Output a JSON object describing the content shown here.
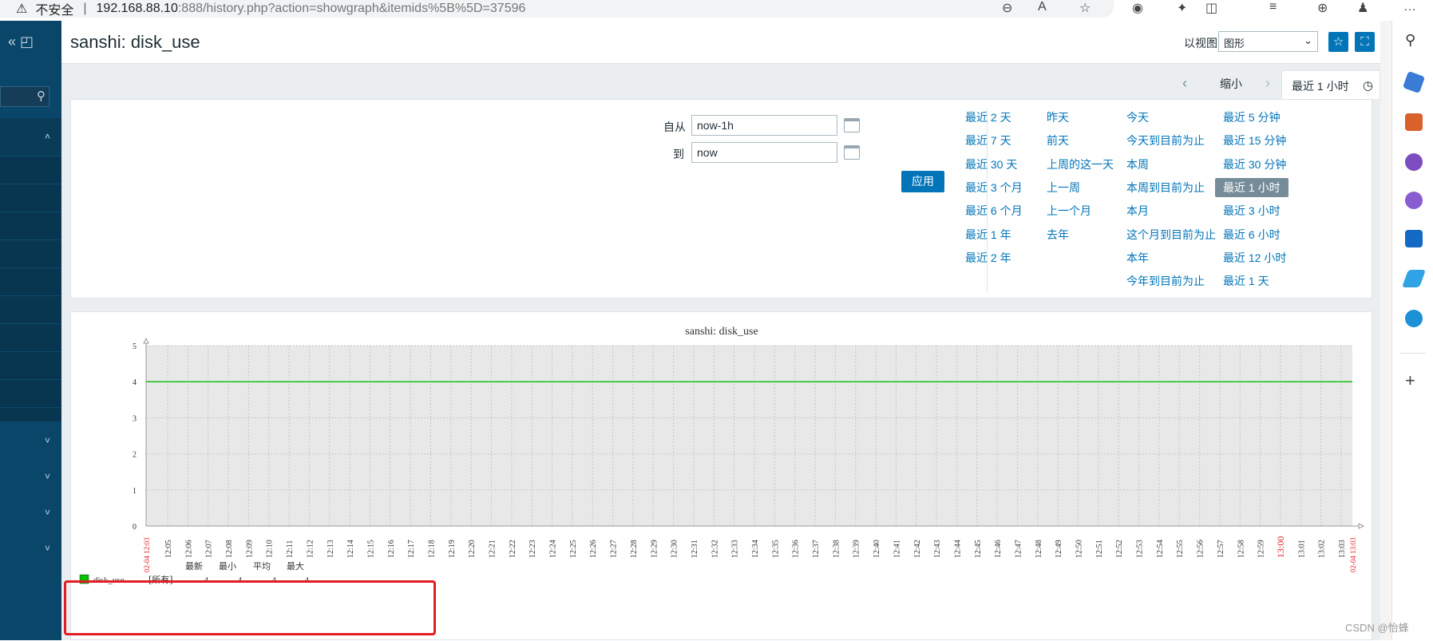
{
  "browser": {
    "security": "不安全",
    "url_host": "192.168.88.10",
    "url_rest": ":888/history.php?action=showgraph&itemids%5B%5D=37596"
  },
  "header": {
    "title": "sanshi: disk_use",
    "view_label": "以视图",
    "view_value": "图形"
  },
  "timeline": {
    "zoom_out": "缩小",
    "active_tab": "最近 1 小时"
  },
  "filter": {
    "from_label": "自从",
    "from_value": "now-1h",
    "to_label": "到",
    "to_value": "now",
    "apply": "应用",
    "col1": [
      "最近 2 天",
      "最近 7 天",
      "最近 30 天",
      "最近 3 个月",
      "最近 6 个月",
      "最近 1 年",
      "最近 2 年"
    ],
    "col2": [
      "昨天",
      "前天",
      "上周的这一天",
      "上一周",
      "上一个月",
      "去年"
    ],
    "col3": [
      "今天",
      "今天到目前为止",
      "本周",
      "本周到目前为止",
      "本月",
      "这个月到目前为止",
      "本年",
      "今年到目前为止"
    ],
    "col4": [
      "最近 5 分钟",
      "最近 15 分钟",
      "最近 30 分钟",
      "最近 1 小时",
      "最近 3 小时",
      "最近 6 小时",
      "最近 12 小时",
      "最近 1 天"
    ],
    "selected": "最近 1 小时"
  },
  "chart_data": {
    "type": "line",
    "title": "sanshi: disk_use",
    "ylim": [
      0,
      5
    ],
    "yticks": [
      0,
      1,
      2,
      3,
      4,
      5
    ],
    "start_label": "02-04 12:03",
    "end_label": "02-04 13:03",
    "x": [
      "12:05",
      "12:06",
      "12:07",
      "12:08",
      "12:09",
      "12:10",
      "12:11",
      "12:12",
      "12:13",
      "12:14",
      "12:15",
      "12:16",
      "12:17",
      "12:18",
      "12:19",
      "12:20",
      "12:21",
      "12:22",
      "12:23",
      "12:24",
      "12:25",
      "12:26",
      "12:27",
      "12:28",
      "12:29",
      "12:30",
      "12:31",
      "12:32",
      "12:33",
      "12:34",
      "12:35",
      "12:36",
      "12:37",
      "12:38",
      "12:39",
      "12:40",
      "12:41",
      "12:42",
      "12:43",
      "12:44",
      "12:45",
      "12:46",
      "12:47",
      "12:48",
      "12:49",
      "12:50",
      "12:51",
      "12:52",
      "12:53",
      "12:54",
      "12:55",
      "12:56",
      "12:57",
      "12:58",
      "12:59",
      "13:00",
      "13:01",
      "13:02",
      "13:03"
    ],
    "highlight_tick": "13:00",
    "series": [
      {
        "name": "disk_use",
        "value": 4,
        "color": "#00c000"
      }
    ],
    "legend": {
      "headers": [
        "最新",
        "最小",
        "平均",
        "最大"
      ],
      "item": "disk_use",
      "func": "[所有]",
      "values": [
        "4",
        "4",
        "4",
        "4"
      ]
    }
  },
  "watermark": "CSDN @怡蜂",
  "colors": {
    "accent": "#0275b8",
    "sidebar": "#0a466a",
    "line": "#00c000",
    "highlight": "#e31b23"
  }
}
